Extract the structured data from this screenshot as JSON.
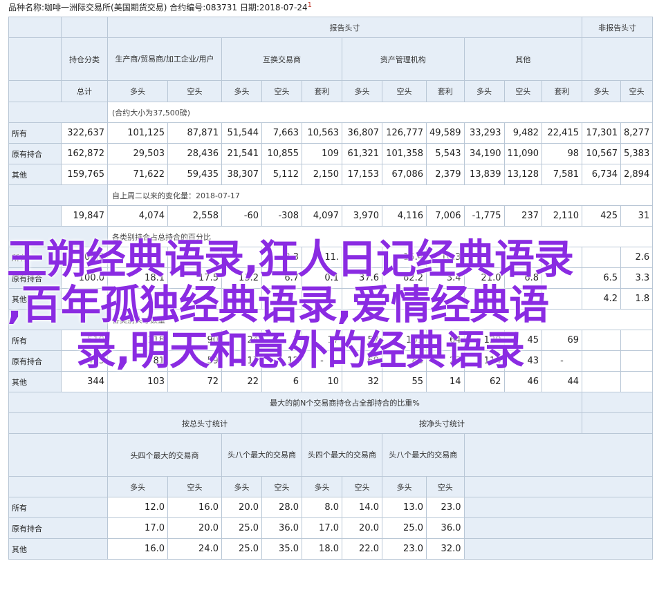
{
  "header": {
    "text": "品种名称:咖啡一洲际交易所(美国期货交易) 合约编号:083731 日期:2018-07-24",
    "sup": "1"
  },
  "col_headers": {
    "report": "报告头寸",
    "nonreport": "非报告头寸",
    "category": "持仓分类",
    "producer": "生产商/贸易商/加工企业/用户",
    "swap": "互换交易商",
    "managed": "资产管理机构",
    "other": "其他",
    "total": "总计",
    "long": "多头",
    "short": "空头",
    "spread": "套利"
  },
  "sections": {
    "s1": "(合约大小为37,500磅)",
    "s2": "自上周二以来的变化量：2018-07-17",
    "s3": "各类别持合占总持合的百分比",
    "s4": "各类别头寸数量",
    "s5": "最大的前N个交易商持仓占全部持合的比重%",
    "s5_gross": "按总头寸统计",
    "s5_net": "按净头寸统计",
    "s5_g4": "头四个最大的交易商",
    "s5_g8": "头八个最大的交易商",
    "s5_n4": "头四个最大的交易商",
    "s5_n8": "头八个最大的交易商"
  },
  "row_labels": {
    "all": "所有",
    "old": "原有持合",
    "other": "其他"
  },
  "block1": {
    "all": [
      "322,637",
      "101,125",
      "87,871",
      "51,544",
      "7,663",
      "10,563",
      "36,807",
      "126,777",
      "49,589",
      "33,293",
      "9,482",
      "22,415",
      "17,301",
      "8,277"
    ],
    "old": [
      "162,872",
      "29,503",
      "28,436",
      "21,541",
      "10,855",
      "109",
      "61,321",
      "101,358",
      "5,543",
      "34,190",
      "11,090",
      "98",
      "10,567",
      "5,383"
    ],
    "other": [
      "159,765",
      "71,622",
      "59,435",
      "38,307",
      "5,112",
      "2,150",
      "17,153",
      "67,086",
      "2,379",
      "13,839",
      "13,128",
      "7,581",
      "6,734",
      "2,894"
    ]
  },
  "block2": {
    "changes": [
      "19,847",
      "4,074",
      "2,558",
      "-60",
      "-308",
      "4,097",
      "3,970",
      "4,116",
      "7,006",
      "-1,775",
      "237",
      "2,110",
      "425",
      "31"
    ]
  },
  "block3": {
    "all": [
      "100.0",
      "",
      "",
      "",
      "3.3",
      "11.",
      "",
      "15.4",
      "10.3",
      "",
      "",
      "",
      "",
      "2.6"
    ],
    "old": [
      "100.0",
      "18.1",
      "17.5",
      "13.2",
      "6.7",
      "0.1",
      "37.6",
      "62.2",
      "3.4",
      "21.0",
      "6.8",
      "",
      "6.5",
      "3.3"
    ],
    "other": [
      "",
      "",
      "",
      "",
      "",
      "",
      "",
      "",
      "",
      "",
      "",
      "",
      "4.2",
      "1.8"
    ]
  },
  "block4": {
    "all": [
      "510",
      "118",
      "90",
      "24",
      "7",
      "17",
      "57",
      "101",
      "64",
      "120",
      "45",
      "69",
      "",
      ""
    ],
    "old": [
      "465",
      "81",
      "59",
      "17",
      "12",
      "-",
      "69",
      "83",
      "27",
      "114",
      "43",
      "-",
      "",
      ""
    ],
    "other": [
      "344",
      "103",
      "72",
      "22",
      "6",
      "10",
      "32",
      "55",
      "14",
      "62",
      "46",
      "44",
      "",
      ""
    ]
  },
  "block5": {
    "all": [
      "12.0",
      "16.0",
      "20.0",
      "28.0",
      "8.0",
      "14.0",
      "13.0",
      "23.0"
    ],
    "old": [
      "17.0",
      "20.0",
      "25.0",
      "36.0",
      "17.0",
      "20.0",
      "25.0",
      "36.0"
    ],
    "other": [
      "16.0",
      "24.0",
      "25.0",
      "35.0",
      "18.0",
      "22.0",
      "23.0",
      "32.0"
    ]
  },
  "overlay": {
    "line1": "王朔经典语录,狂人日记经典语录",
    "line2": ",百年孤独经典语录,爱情经典语",
    "line3": "录,明天和意外的经典语录"
  }
}
